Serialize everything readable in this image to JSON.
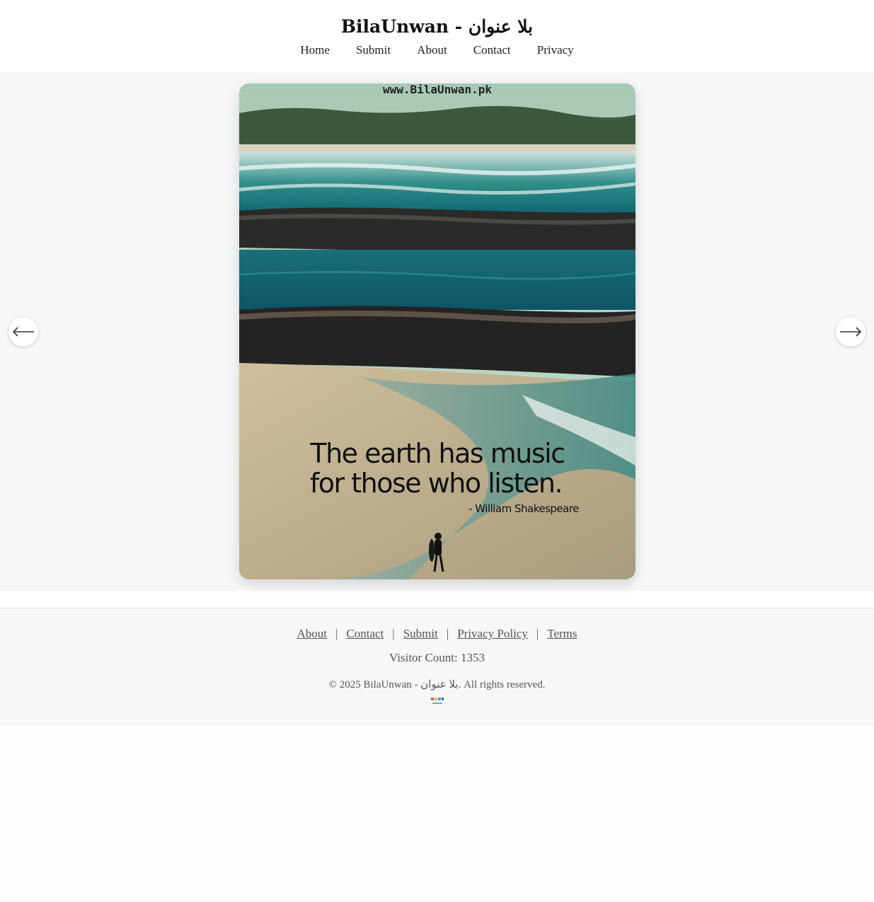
{
  "header": {
    "title": "BilaUnwan - بلا عنوان",
    "nav": [
      "Home",
      "Submit",
      "About",
      "Contact",
      "Privacy"
    ]
  },
  "carousel": {
    "image": {
      "watermark": "www.BilaUnwan.pk",
      "quote_line1": "The earth has music",
      "quote_line2": "for those who listen.",
      "author": "- William Shakespeare"
    },
    "prev_icon": "arrow-left-icon",
    "next_icon": "arrow-right-icon"
  },
  "footer": {
    "links": [
      "About",
      "Contact",
      "Submit",
      "Privacy Policy",
      "Terms"
    ],
    "separator": "|",
    "visitor_count": "Visitor Count: 1353",
    "copyright": "© 2025 BilaUnwan - بلا عنوان. All rights reserved."
  },
  "colors": {
    "page_bg": "#f6f7f9",
    "text": "#222222",
    "link": "#555555",
    "sea": "#1f7f80",
    "sand": "#c9b89a"
  }
}
